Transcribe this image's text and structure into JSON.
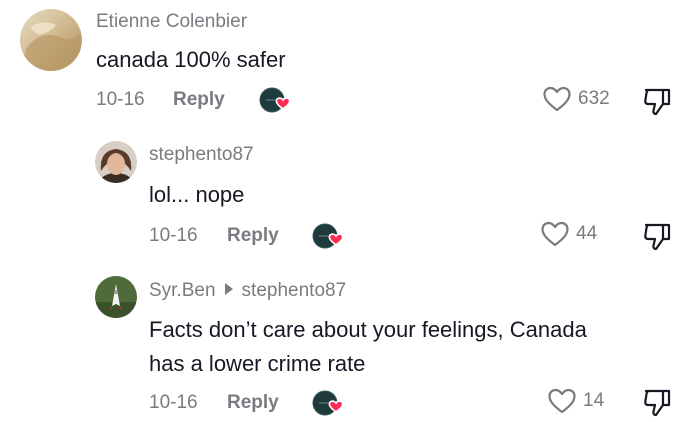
{
  "comments": [
    {
      "username": "Etienne Colenbier",
      "text": "canada 100% safer",
      "date": "10-16",
      "reply_label": "Reply",
      "likes": "632"
    },
    {
      "username": "stephento87",
      "text": "lol... nope",
      "date": "10-16",
      "reply_label": "Reply",
      "likes": "44"
    },
    {
      "username": "Syr.Ben",
      "reply_to": "stephento87",
      "text_line1": "Facts don’t care about your feelings, Canada",
      "text_line2": "has a lower crime rate",
      "date": "10-16",
      "reply_label": "Reply",
      "likes": "14"
    }
  ],
  "icons": {
    "like": "heart-outline-icon",
    "dislike": "thumbs-down-icon",
    "creator_liked": "creator-liked-badge"
  },
  "colors": {
    "heart_badge": "#fe2c55",
    "meta_text": "#7a7b80",
    "primary_text": "#161823"
  }
}
